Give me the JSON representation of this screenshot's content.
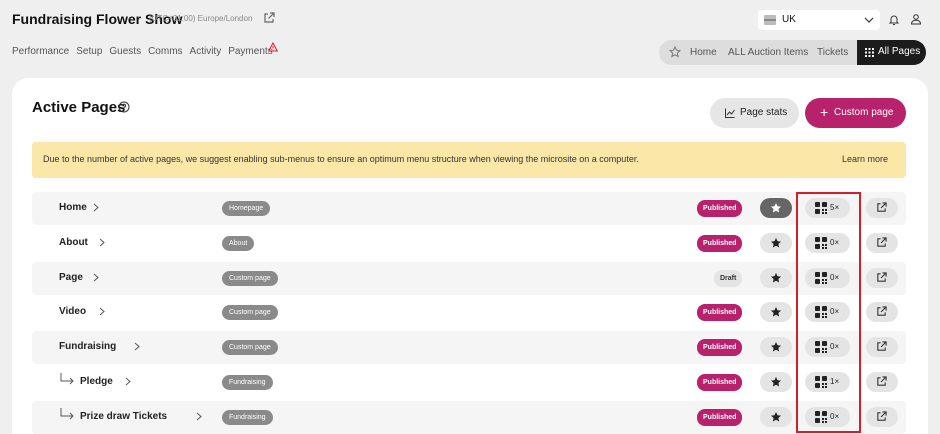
{
  "app": {
    "title": "Fundraising Flower Show",
    "timezone": "(UTC+01:00) Europe/London",
    "country": "UK"
  },
  "nav": [
    "Performance",
    "Setup",
    "Guests",
    "Comms",
    "Activity",
    "Payments"
  ],
  "tabs": {
    "items": [
      "Home",
      "ALL Auction Items",
      "Tickets"
    ],
    "active": "All Pages"
  },
  "page": {
    "title": "Active Pages",
    "stats_label": "Page stats",
    "custom_label": "Custom page"
  },
  "notice": {
    "text": "Due to the number of active pages, we suggest enabling sub-menus to ensure an optimum menu structure when viewing the microsite on a computer.",
    "link": "Learn more"
  },
  "rows": [
    {
      "name": "Home",
      "tag": "Homepage",
      "status": "Published",
      "star": true,
      "qr": "5×",
      "sub": false
    },
    {
      "name": "About",
      "tag": "About",
      "status": "Published",
      "star": false,
      "qr": "0×",
      "sub": false
    },
    {
      "name": "Page",
      "tag": "Custom page",
      "status": "Draft",
      "star": false,
      "qr": "0×",
      "sub": false
    },
    {
      "name": "Video",
      "tag": "Custom page",
      "status": "Published",
      "star": false,
      "qr": "0×",
      "sub": false
    },
    {
      "name": "Fundraising",
      "tag": "Custom page",
      "status": "Published",
      "star": false,
      "qr": "0×",
      "sub": false
    },
    {
      "name": "Pledge",
      "tag": "Fundraising",
      "status": "Published",
      "star": false,
      "qr": "1×",
      "sub": true
    },
    {
      "name": "Prize draw Tickets",
      "tag": "Fundraising",
      "status": "Published",
      "star": false,
      "qr": "0×",
      "sub": true
    }
  ],
  "colors": {
    "accent": "#b8216b",
    "notice": "#fbe7a7",
    "highlight": "#d41f2b"
  }
}
